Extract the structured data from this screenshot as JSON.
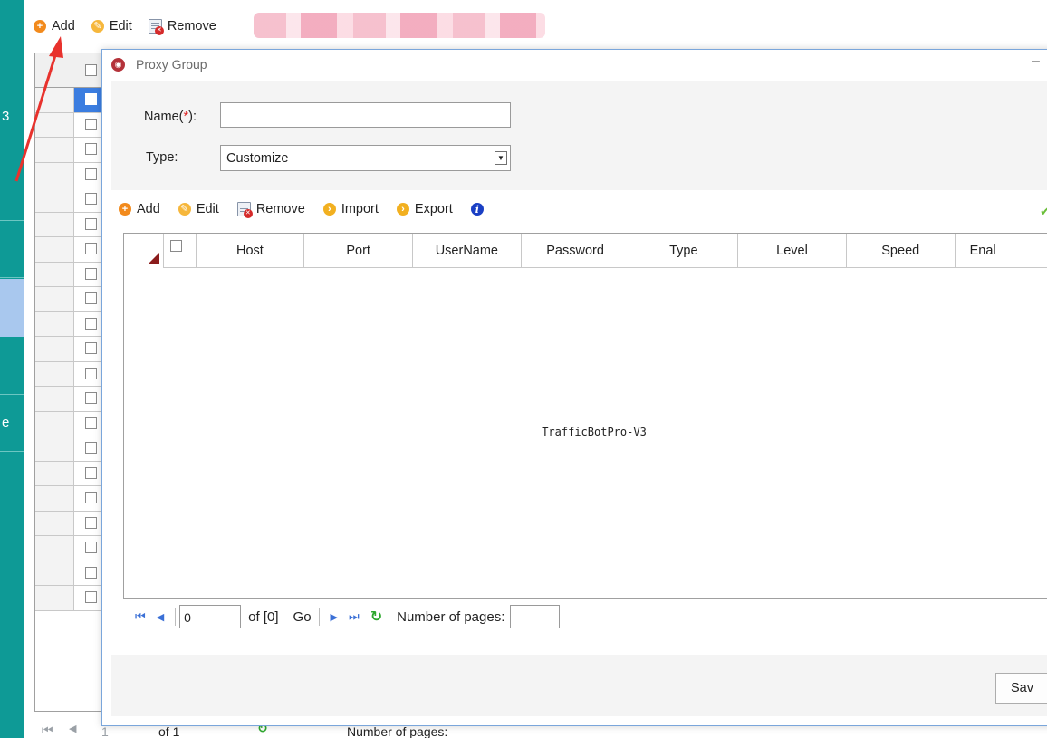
{
  "sidebar": {
    "fragments": [
      "3",
      "e"
    ],
    "accent": "#0e9a96"
  },
  "toolbar": {
    "add_label": "Add",
    "edit_label": "Edit",
    "remove_label": "Remove"
  },
  "dialog": {
    "title": "Proxy Group",
    "minimize_glyph": "–",
    "form": {
      "name_label": "Name(",
      "name_required_mark": "*",
      "name_label_suffix": "):",
      "name_value": "",
      "type_label": "Type:",
      "type_value": "Customize"
    },
    "toolbar": {
      "add_label": "Add",
      "edit_label": "Edit",
      "remove_label": "Remove",
      "import_label": "Import",
      "export_label": "Export",
      "info_glyph": "i"
    },
    "grid": {
      "columns": [
        "Host",
        "Port",
        "UserName",
        "Password",
        "Type",
        "Level",
        "Speed",
        "Enal"
      ],
      "watermark": "TrafficBotPro-V3"
    },
    "pager": {
      "page_value": "0",
      "of_label": "of [0]",
      "go_label": "Go",
      "pages_label": "Number of pages:"
    },
    "save_label": "Sav"
  },
  "background_pager": {
    "page_value": "1",
    "of_label": "of 1",
    "pages_label": "Number of pages:"
  },
  "colors": {
    "brand": "#0e9a96",
    "selection": "#3b7de0",
    "annotation_arrow": "#e8322d"
  }
}
